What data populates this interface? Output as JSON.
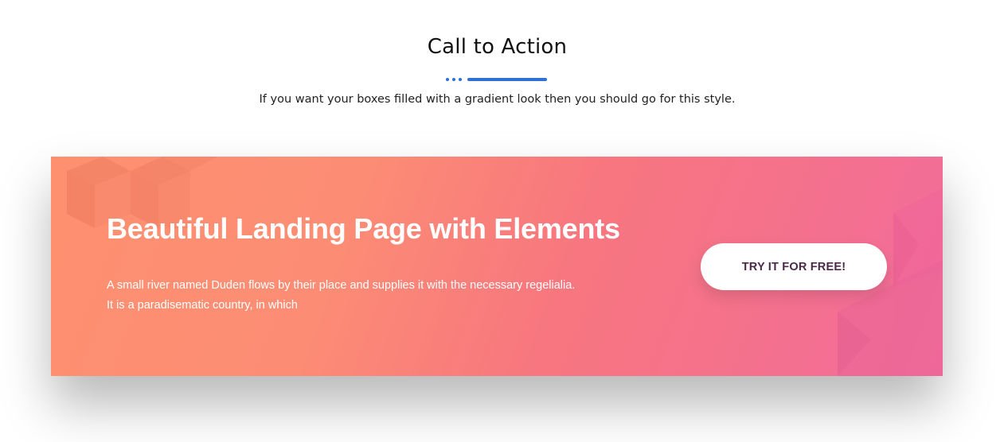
{
  "section": {
    "title": "Call to Action",
    "subtitle": "If you want your boxes filled with a gradient look then you should go for this style."
  },
  "colors": {
    "accent": "#2f6fd8",
    "gradient_start": "#fe9070",
    "gradient_end": "#f26c9b",
    "button_text": "#4a2846"
  },
  "cta": {
    "heading": "Beautiful Landing Page with Elements",
    "text_line1": "A small river named Duden flows by their place and supplies it with the necessary regelialia.",
    "text_line2": "It is a paradisematic country, in which",
    "button_label": "TRY IT FOR FREE!"
  }
}
